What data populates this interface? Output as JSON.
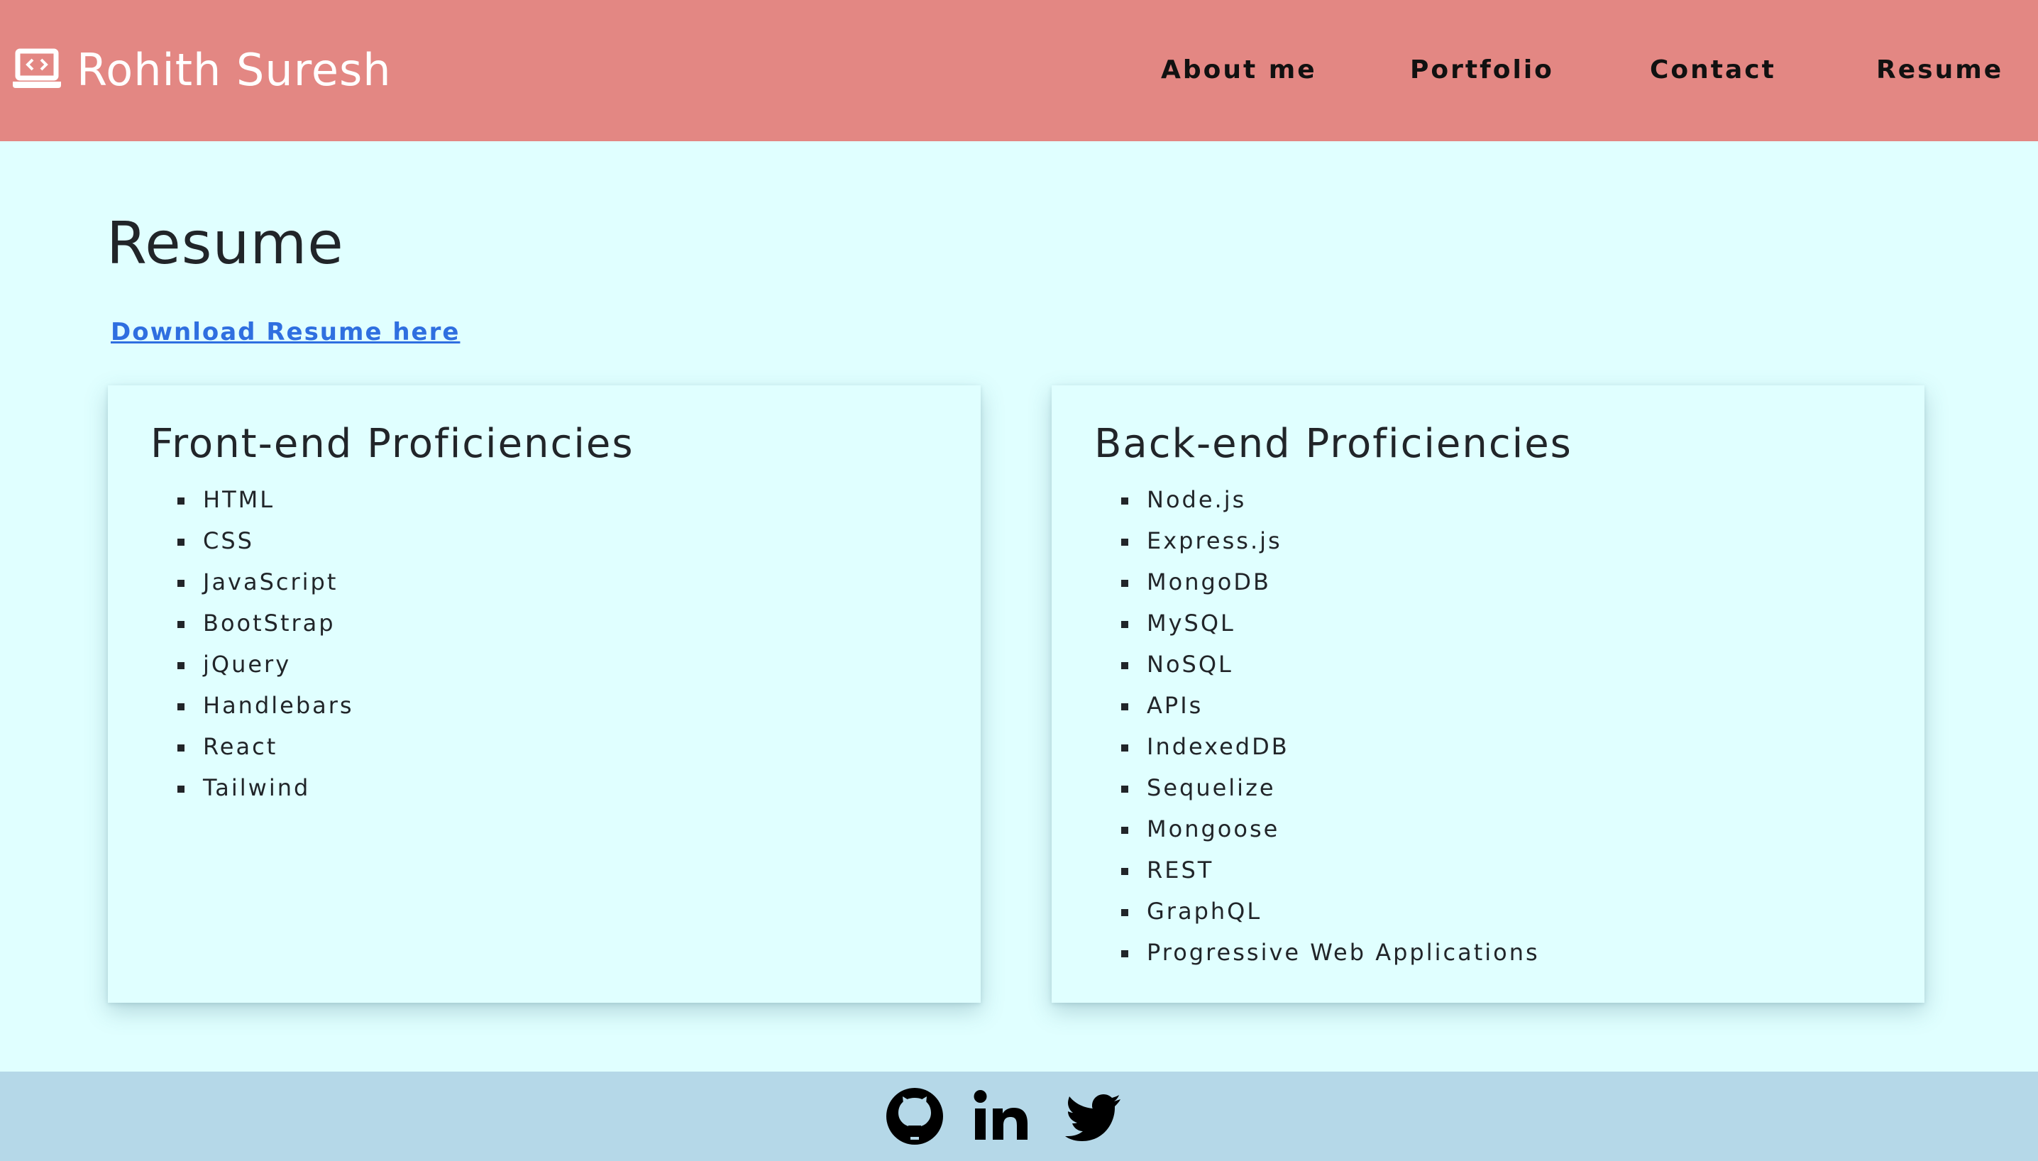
{
  "header": {
    "brand_name": "Rohith Suresh",
    "brand_icon": "laptop-code-icon",
    "background": "#e38783",
    "nav": {
      "about": "About me",
      "portfolio": "Portfolio",
      "contact": "Contact",
      "resume": "Resume"
    }
  },
  "main": {
    "title": "Resume",
    "download_label": "Download Resume here",
    "link_color": "#2f6fe0",
    "background": "#e0ffff",
    "front_end": {
      "title": "Front-end Proficiencies",
      "items": [
        "HTML",
        "CSS",
        "JavaScript",
        "BootStrap",
        "jQuery",
        "Handlebars",
        "React",
        "Tailwind"
      ]
    },
    "back_end": {
      "title": "Back-end Proficiencies",
      "items": [
        "Node.js",
        "Express.js",
        "MongoDB",
        "MySQL",
        "NoSQL",
        "APIs",
        "IndexedDB",
        "Sequelize",
        "Mongoose",
        "REST",
        "GraphQL",
        "Progressive Web Applications"
      ]
    }
  },
  "footer": {
    "background": "#b5d8e8",
    "icons": [
      "github-icon",
      "linkedin-icon",
      "twitter-icon"
    ]
  }
}
